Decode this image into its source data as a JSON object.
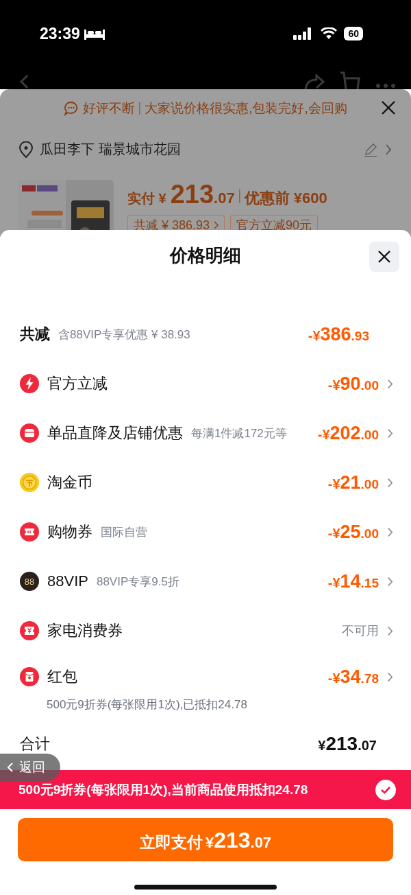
{
  "status_bar": {
    "time": "23:39",
    "battery": "60"
  },
  "background_page": {
    "review_banner": {
      "title": "好评不断",
      "text": "大家说价格很实惠,包装完好,会回购"
    },
    "address": "瓜田李下 瑞景城市花园",
    "product": {
      "paid_label": "实付 ¥",
      "paid_int": "213",
      "paid_dec": ".07",
      "before_price": "优惠前 ¥600",
      "tags": [
        "共减 ¥ 386.93",
        "官方立减90元"
      ]
    }
  },
  "sheet": {
    "title": "价格明细",
    "summary": {
      "label": "共减",
      "note": "含88VIP专享优惠 ¥ 38.93",
      "amount": {
        "sign": "-¥",
        "int": "386",
        "dec": ".93"
      }
    },
    "items": [
      {
        "kind": "bolt",
        "label": "官方立减",
        "amount": {
          "sign": "-¥",
          "int": "90",
          "dec": ".00"
        }
      },
      {
        "kind": "store",
        "label": "单品直降及店铺优惠",
        "note": "每满1件减172元等",
        "amount": {
          "sign": "-¥",
          "int": "202",
          "dec": ".00"
        }
      },
      {
        "kind": "coin",
        "label": "淘金币",
        "amount": {
          "sign": "-¥",
          "int": "21",
          "dec": ".00"
        }
      },
      {
        "kind": "ticket",
        "label": "购物券",
        "note": "国际自营",
        "amount": {
          "sign": "-¥",
          "int": "25",
          "dec": ".00"
        }
      },
      {
        "kind": "vip",
        "badge_text": "88",
        "label": "88VIP",
        "note": "88VIP专享9.5折",
        "amount": {
          "sign": "-¥",
          "int": "14",
          "dec": ".15"
        }
      },
      {
        "kind": "voucher",
        "label": "家电消费券",
        "status": "不可用"
      },
      {
        "kind": "redpacket",
        "label": "红包",
        "amount": {
          "sign": "-¥",
          "int": "34",
          "dec": ".78"
        },
        "detail": "500元9折券(每张限用1次),已抵扣24.78"
      }
    ],
    "total": {
      "label": "合计",
      "amount": {
        "sign": "¥",
        "int": "213",
        "dec": ".07"
      }
    },
    "back_button": "返回",
    "coupon_banner": {
      "text": "500元9折券(每张限用1次),当前商品使用抵扣24.78",
      "checked": true
    },
    "pay_button": {
      "label": "立即支付",
      "sign": "¥",
      "int": "213",
      "dec": ".07"
    }
  }
}
